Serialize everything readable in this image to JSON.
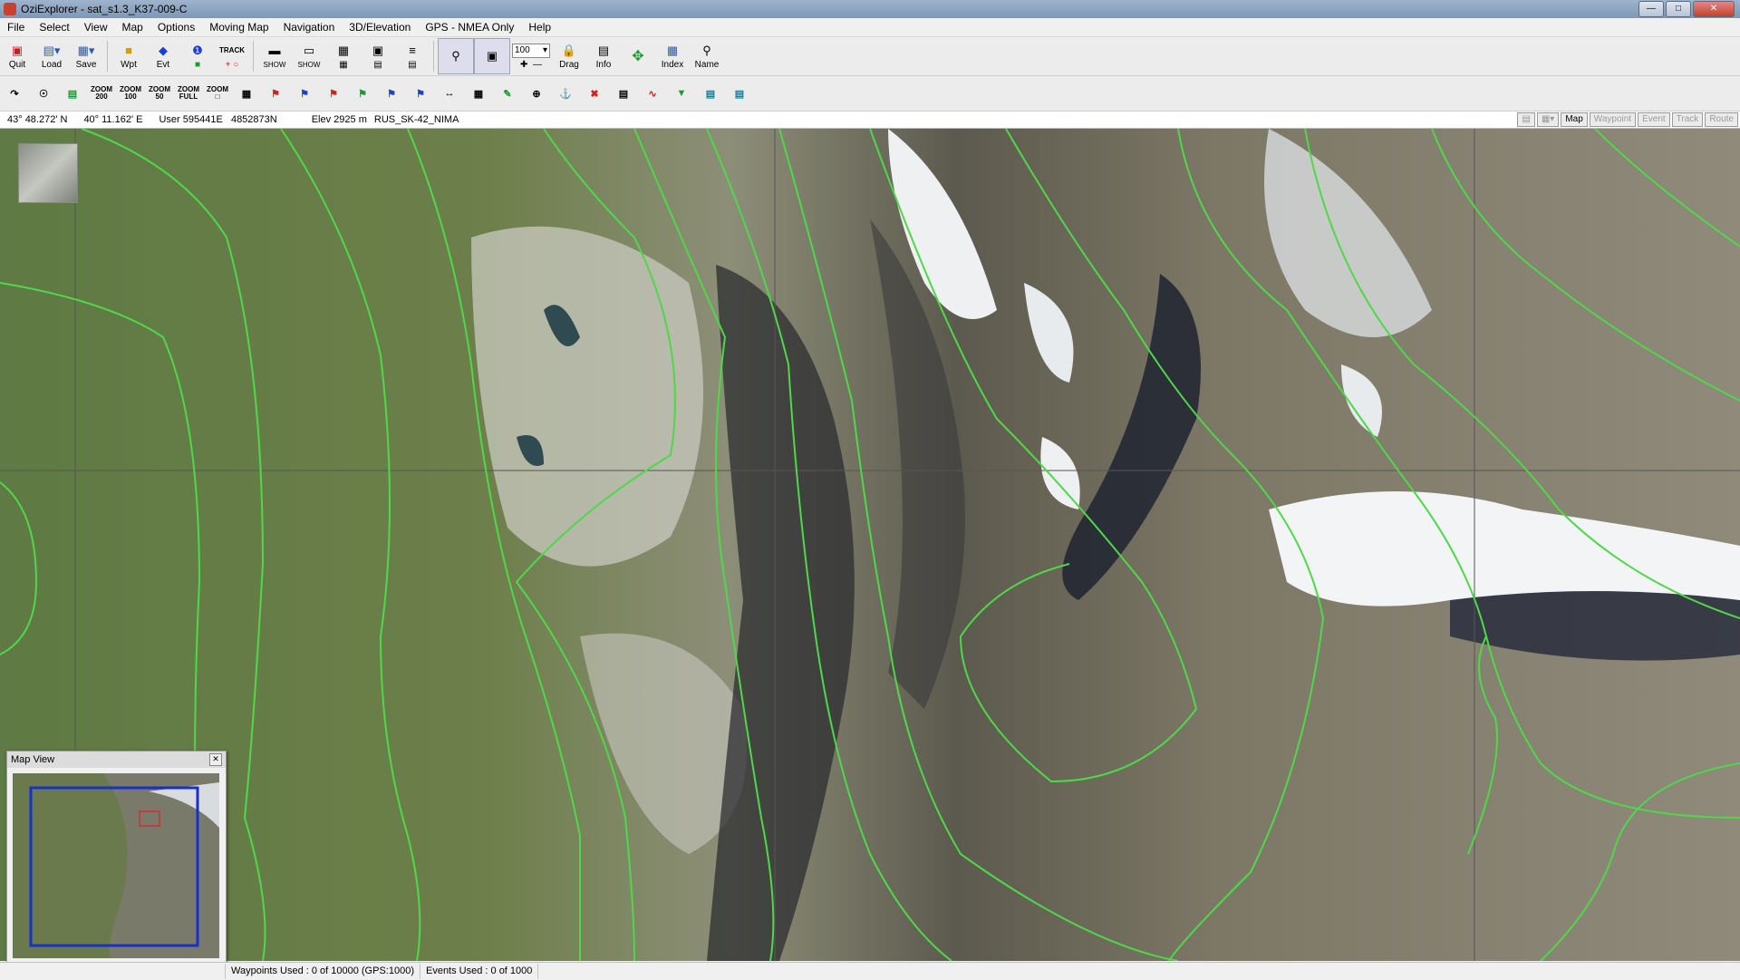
{
  "window": {
    "title": "OziExplorer - sat_s1.3_K37-009-C"
  },
  "menu": [
    "File",
    "Select",
    "View",
    "Map",
    "Options",
    "Moving Map",
    "Navigation",
    "3D/Elevation",
    "GPS - NMEA Only",
    "Help"
  ],
  "toolbar1": {
    "quit": "Quit",
    "load": "Load",
    "save": "Save",
    "wpt": "Wpt",
    "evt": "Evt",
    "track": "TRACK",
    "show": "SHOW",
    "show2": "SHOW",
    "zoom_value": "100",
    "drag": "Drag",
    "info": "Info",
    "index": "Index",
    "name": "Name"
  },
  "toolbar2": {
    "zoom200": "200",
    "zoom100": "100",
    "zoom50": "50",
    "zoomfull": "FULL",
    "zoom": "ZOOM"
  },
  "info": {
    "lat": "43° 48.272' N",
    "lon": "40° 11.162' E",
    "user": "User 595441E   4852873N",
    "elev": "Elev 2925 m",
    "datum": "RUS_SK-42_NIMA"
  },
  "modes": [
    "Map",
    "Waypoint",
    "Event",
    "Track",
    "Route"
  ],
  "status": {
    "waypoints": "Waypoints Used : 0 of 10000  (GPS:1000)",
    "events": "Events Used : 0 of 1000"
  },
  "mapview": {
    "title": "Map View"
  },
  "colors": {
    "contour": "#4ed84a",
    "viewbox": "#1630c8",
    "grid": "#555555"
  }
}
